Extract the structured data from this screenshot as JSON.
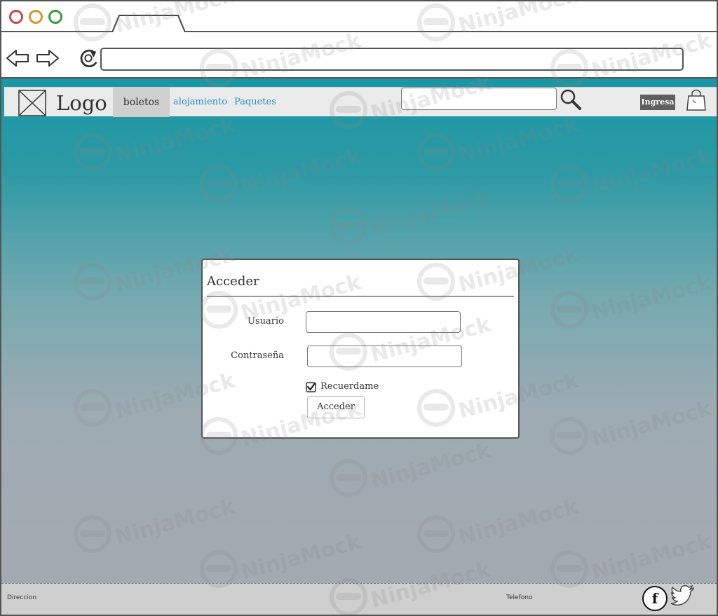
{
  "browser": {
    "window_controls": [
      "close",
      "minimize",
      "maximize"
    ],
    "nav_icons": [
      "back-arrow-icon",
      "forward-arrow-icon",
      "reload-icon"
    ],
    "address": ""
  },
  "site_header": {
    "logo_text": "Logo",
    "menu": [
      {
        "label": "boletos",
        "active": true
      },
      {
        "label": "alojamiento",
        "active": false
      },
      {
        "label": "Paquetes",
        "active": false
      }
    ],
    "search": {
      "value": "",
      "placeholder": ""
    },
    "login_label": "Ingresa"
  },
  "login_panel": {
    "title": "Acceder",
    "username_label": "Usuario",
    "username_value": "",
    "password_label": "Contraseña",
    "password_value": "",
    "remember_label": "Recuerdame",
    "remember_checked": true,
    "submit_label": "Acceder"
  },
  "footer": {
    "address_label": "Direccion",
    "phone_label": "Telefono",
    "social": [
      "facebook-icon",
      "twitter-icon"
    ],
    "facebook_glyph": "f"
  },
  "watermark_text": "NinjaMock",
  "colors": {
    "header_teal": "#1a97a3",
    "link_blue": "#2a8fc4",
    "login_button_bg": "#5f5f5f"
  }
}
